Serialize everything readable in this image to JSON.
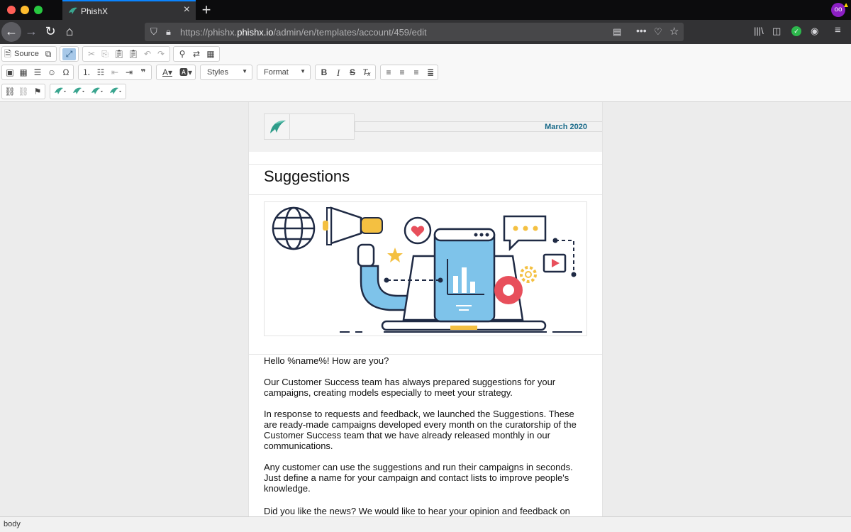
{
  "browser": {
    "tab_title": "PhishX",
    "url_prefix": "https://phishx.",
    "url_domain": "phishx.io",
    "url_path": "/admin/en/templates/account/459/edit"
  },
  "editor": {
    "source_label": "Source",
    "styles_label": "Styles",
    "format_label": "Format"
  },
  "email": {
    "date": "March 2020",
    "title": "Suggestions",
    "paragraphs": [
      "Hello %name%! How are you?",
      "Our Customer Success team has always prepared suggestions for your campaigns, creating models especially to meet your strategy.",
      "In response to requests and feedback, we launched the Suggestions. These are ready-made campaigns developed every month on the curatorship of the Customer Success team that we have already released monthly in our communications.",
      "Any customer can use the suggestions and run their campaigns in seconds. Just define a name for your campaign and contact lists to improve people's knowledge.",
      "Did you like the news? We would like to hear your opinion and feedback on how"
    ]
  },
  "status": {
    "path": "body"
  },
  "colors": {
    "accent": "#1a6b8a",
    "tab_highlight": "#0a84ff",
    "hero_blue": "#7ec3ea"
  }
}
